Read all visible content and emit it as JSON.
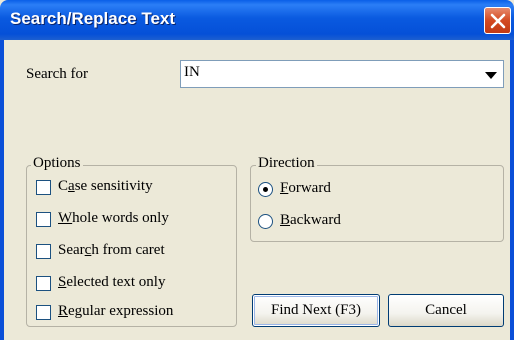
{
  "window": {
    "title": "Search/Replace Text"
  },
  "search": {
    "label": "Search for",
    "value": "IN"
  },
  "options": {
    "title": "Options",
    "items": [
      {
        "label": "Case sensitivity",
        "accel": "a",
        "checked": false
      },
      {
        "label": "Whole words only",
        "accel": "W",
        "checked": false
      },
      {
        "label": "Search from caret",
        "accel": "c",
        "checked": false
      },
      {
        "label": "Selected text only",
        "accel": "S",
        "checked": false
      },
      {
        "label": "Regular expression",
        "accel": "R",
        "checked": false
      }
    ]
  },
  "direction": {
    "title": "Direction",
    "options": [
      {
        "label": "Forward",
        "accel": "F",
        "selected": true
      },
      {
        "label": "Backward",
        "accel": "B",
        "selected": false
      }
    ]
  },
  "buttons": {
    "find_next": "Find Next (F3)",
    "cancel": "Cancel"
  },
  "colors": {
    "titlebar": "#0A5AE0",
    "dialog_bg": "#ECE9D8",
    "close_button": "#D34A22"
  }
}
